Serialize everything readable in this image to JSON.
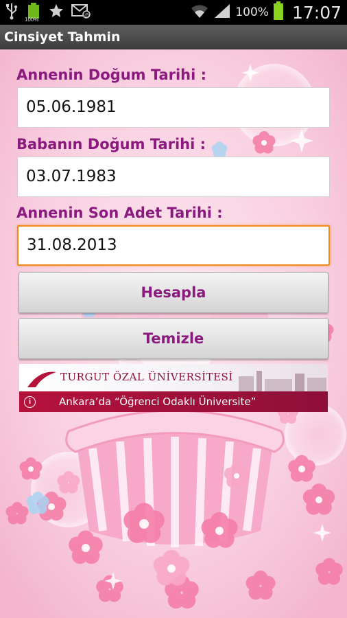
{
  "status_bar": {
    "notification_icons": [
      "usb-icon",
      "battery-small-icon",
      "star-icon",
      "mail-icon"
    ],
    "small_battery_text": "100%",
    "signal_icons": [
      "wifi-icon",
      "cell-signal-icon"
    ],
    "battery_percent": "100%",
    "clock": "17:07"
  },
  "app": {
    "title": "Cinsiyet Tahmin"
  },
  "form": {
    "mother_birth_label": "Annenin Doğum Tarihi :",
    "mother_birth_value": "05.06.1981",
    "father_birth_label": "Babanın Doğum Tarihi :",
    "father_birth_value": "03.07.1983",
    "last_period_label": "Annenin Son Adet Tarihi :",
    "last_period_value": "31.08.2013"
  },
  "buttons": {
    "calculate": "Hesapla",
    "clear": "Temizle"
  },
  "ad": {
    "title": "TURGUT ÖZAL ÜNİVERSİTESİ",
    "tagline": "Ankara’da “Öğrenci Odaklı Üniversite”",
    "info_icon": "info-icon"
  },
  "colors": {
    "label": "#8a1a7d",
    "focus": "#f08a1c",
    "background": "#f7c9dd",
    "ad_banner": "#b5123b"
  }
}
